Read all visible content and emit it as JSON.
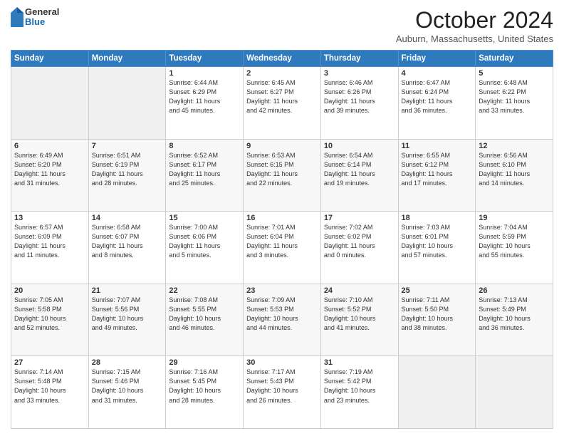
{
  "header": {
    "logo": {
      "general": "General",
      "blue": "Blue"
    },
    "title": "October 2024",
    "location": "Auburn, Massachusetts, United States"
  },
  "calendar": {
    "days_of_week": [
      "Sunday",
      "Monday",
      "Tuesday",
      "Wednesday",
      "Thursday",
      "Friday",
      "Saturday"
    ],
    "weeks": [
      [
        {
          "day": "",
          "info": ""
        },
        {
          "day": "",
          "info": ""
        },
        {
          "day": "1",
          "info": "Sunrise: 6:44 AM\nSunset: 6:29 PM\nDaylight: 11 hours\nand 45 minutes."
        },
        {
          "day": "2",
          "info": "Sunrise: 6:45 AM\nSunset: 6:27 PM\nDaylight: 11 hours\nand 42 minutes."
        },
        {
          "day": "3",
          "info": "Sunrise: 6:46 AM\nSunset: 6:26 PM\nDaylight: 11 hours\nand 39 minutes."
        },
        {
          "day": "4",
          "info": "Sunrise: 6:47 AM\nSunset: 6:24 PM\nDaylight: 11 hours\nand 36 minutes."
        },
        {
          "day": "5",
          "info": "Sunrise: 6:48 AM\nSunset: 6:22 PM\nDaylight: 11 hours\nand 33 minutes."
        }
      ],
      [
        {
          "day": "6",
          "info": "Sunrise: 6:49 AM\nSunset: 6:20 PM\nDaylight: 11 hours\nand 31 minutes."
        },
        {
          "day": "7",
          "info": "Sunrise: 6:51 AM\nSunset: 6:19 PM\nDaylight: 11 hours\nand 28 minutes."
        },
        {
          "day": "8",
          "info": "Sunrise: 6:52 AM\nSunset: 6:17 PM\nDaylight: 11 hours\nand 25 minutes."
        },
        {
          "day": "9",
          "info": "Sunrise: 6:53 AM\nSunset: 6:15 PM\nDaylight: 11 hours\nand 22 minutes."
        },
        {
          "day": "10",
          "info": "Sunrise: 6:54 AM\nSunset: 6:14 PM\nDaylight: 11 hours\nand 19 minutes."
        },
        {
          "day": "11",
          "info": "Sunrise: 6:55 AM\nSunset: 6:12 PM\nDaylight: 11 hours\nand 17 minutes."
        },
        {
          "day": "12",
          "info": "Sunrise: 6:56 AM\nSunset: 6:10 PM\nDaylight: 11 hours\nand 14 minutes."
        }
      ],
      [
        {
          "day": "13",
          "info": "Sunrise: 6:57 AM\nSunset: 6:09 PM\nDaylight: 11 hours\nand 11 minutes."
        },
        {
          "day": "14",
          "info": "Sunrise: 6:58 AM\nSunset: 6:07 PM\nDaylight: 11 hours\nand 8 minutes."
        },
        {
          "day": "15",
          "info": "Sunrise: 7:00 AM\nSunset: 6:06 PM\nDaylight: 11 hours\nand 5 minutes."
        },
        {
          "day": "16",
          "info": "Sunrise: 7:01 AM\nSunset: 6:04 PM\nDaylight: 11 hours\nand 3 minutes."
        },
        {
          "day": "17",
          "info": "Sunrise: 7:02 AM\nSunset: 6:02 PM\nDaylight: 11 hours\nand 0 minutes."
        },
        {
          "day": "18",
          "info": "Sunrise: 7:03 AM\nSunset: 6:01 PM\nDaylight: 10 hours\nand 57 minutes."
        },
        {
          "day": "19",
          "info": "Sunrise: 7:04 AM\nSunset: 5:59 PM\nDaylight: 10 hours\nand 55 minutes."
        }
      ],
      [
        {
          "day": "20",
          "info": "Sunrise: 7:05 AM\nSunset: 5:58 PM\nDaylight: 10 hours\nand 52 minutes."
        },
        {
          "day": "21",
          "info": "Sunrise: 7:07 AM\nSunset: 5:56 PM\nDaylight: 10 hours\nand 49 minutes."
        },
        {
          "day": "22",
          "info": "Sunrise: 7:08 AM\nSunset: 5:55 PM\nDaylight: 10 hours\nand 46 minutes."
        },
        {
          "day": "23",
          "info": "Sunrise: 7:09 AM\nSunset: 5:53 PM\nDaylight: 10 hours\nand 44 minutes."
        },
        {
          "day": "24",
          "info": "Sunrise: 7:10 AM\nSunset: 5:52 PM\nDaylight: 10 hours\nand 41 minutes."
        },
        {
          "day": "25",
          "info": "Sunrise: 7:11 AM\nSunset: 5:50 PM\nDaylight: 10 hours\nand 38 minutes."
        },
        {
          "day": "26",
          "info": "Sunrise: 7:13 AM\nSunset: 5:49 PM\nDaylight: 10 hours\nand 36 minutes."
        }
      ],
      [
        {
          "day": "27",
          "info": "Sunrise: 7:14 AM\nSunset: 5:48 PM\nDaylight: 10 hours\nand 33 minutes."
        },
        {
          "day": "28",
          "info": "Sunrise: 7:15 AM\nSunset: 5:46 PM\nDaylight: 10 hours\nand 31 minutes."
        },
        {
          "day": "29",
          "info": "Sunrise: 7:16 AM\nSunset: 5:45 PM\nDaylight: 10 hours\nand 28 minutes."
        },
        {
          "day": "30",
          "info": "Sunrise: 7:17 AM\nSunset: 5:43 PM\nDaylight: 10 hours\nand 26 minutes."
        },
        {
          "day": "31",
          "info": "Sunrise: 7:19 AM\nSunset: 5:42 PM\nDaylight: 10 hours\nand 23 minutes."
        },
        {
          "day": "",
          "info": ""
        },
        {
          "day": "",
          "info": ""
        }
      ]
    ]
  }
}
